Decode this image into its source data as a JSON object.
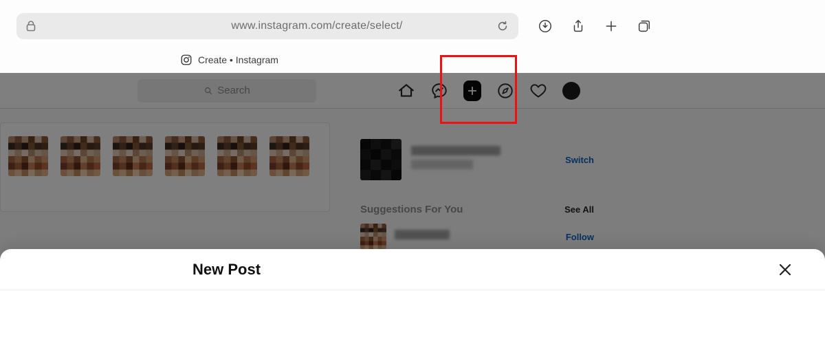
{
  "browser": {
    "url": "www.instagram.com/create/select/",
    "toolbar": {
      "download": "download-icon",
      "share": "share-icon",
      "new_tab": "plus-icon",
      "tabs": "tabs-icon",
      "reload": "reload-icon",
      "lock": "lock-icon"
    }
  },
  "tab": {
    "title": "Create • Instagram"
  },
  "ig": {
    "search_placeholder": "Search",
    "nav": {
      "home": "home-icon",
      "messenger": "messenger-icon",
      "create": "plus-icon",
      "explore": "compass-icon",
      "activity": "heart-icon",
      "profile": "avatar"
    },
    "sidebar": {
      "switch_label": "Switch",
      "suggestions_heading": "Suggestions For You",
      "see_all_label": "See All",
      "follow_label": "Follow"
    }
  },
  "sheet": {
    "title": "New Post"
  },
  "highlight": {
    "target": "create-post-nav-button"
  },
  "pixelate_colors": {
    "story": [
      [
        "#b98a6d",
        "#8d5a3d",
        "#caa184",
        "#6f4227",
        "#d9bda4",
        "#8d5a3d"
      ],
      [
        "#3a2a20",
        "#63412b",
        "#2d1f17",
        "#805735",
        "#4a3324",
        "#5d3f2a"
      ],
      [
        "#e2cbb8",
        "#c7a88f",
        "#efd9c7",
        "#b18d70",
        "#d8bca3",
        "#c9ab92"
      ],
      [
        "#a46542",
        "#c08861",
        "#8a5232",
        "#dfb48e",
        "#b2774d",
        "#cf9a6e"
      ],
      [
        "#7a3f2a",
        "#a65e3d",
        "#5f2d1b",
        "#c77f55",
        "#8e4a2e",
        "#b86b44"
      ],
      [
        "#d6a079",
        "#e7bf9a",
        "#c18a5f",
        "#f0d1b1",
        "#cda07a",
        "#e0b58d"
      ]
    ],
    "user": [
      [
        "#0c0c0c",
        "#1c1c1c",
        "#121212",
        "#2a2a2a"
      ],
      [
        "#181818",
        "#0a0a0a",
        "#222222",
        "#141414"
      ],
      [
        "#101010",
        "#262626",
        "#0e0e0e",
        "#1a1a1a"
      ],
      [
        "#202020",
        "#121212",
        "#282828",
        "#0c0c0c"
      ]
    ]
  }
}
